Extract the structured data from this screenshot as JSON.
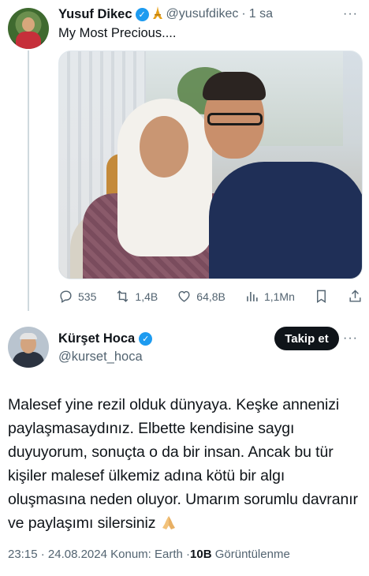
{
  "tweet1": {
    "name": "Yusuf Dikec",
    "handle": "@yusufdikec",
    "separator": "·",
    "time": "1 sa",
    "text": "My Most Precious....",
    "more": "···",
    "stats": {
      "replies": "535",
      "reposts": "1,4B",
      "likes": "64,8B",
      "views": "1,1Mn"
    }
  },
  "tweet2": {
    "name": "Kürşet Hoca",
    "handle": "@kurset_hoca",
    "follow_label": "Takip et",
    "more": "···",
    "text": "Malesef yine rezil olduk dünyaya. Keşke annenizi paylaşmasaydınız. Elbette kendisine saygı duyuyorum, sonuçta o da bir insan. Ancak bu tür kişiler malesef ülkemiz adına kötü bir algı oluşmasına neden oluyor. Umarım sorumlu davranır ve paylaşımı silersiniz",
    "time": "23:15",
    "dot": "·",
    "date": "24.08.2024",
    "location": "Konum: Earth",
    "dot2": "·",
    "views_count": "10B",
    "views_label": "Görüntülenme"
  },
  "colors": {
    "verified": "#1d9bf0",
    "text": "#0f1419",
    "secondary": "#536471",
    "follow_bg": "#0f1419"
  }
}
